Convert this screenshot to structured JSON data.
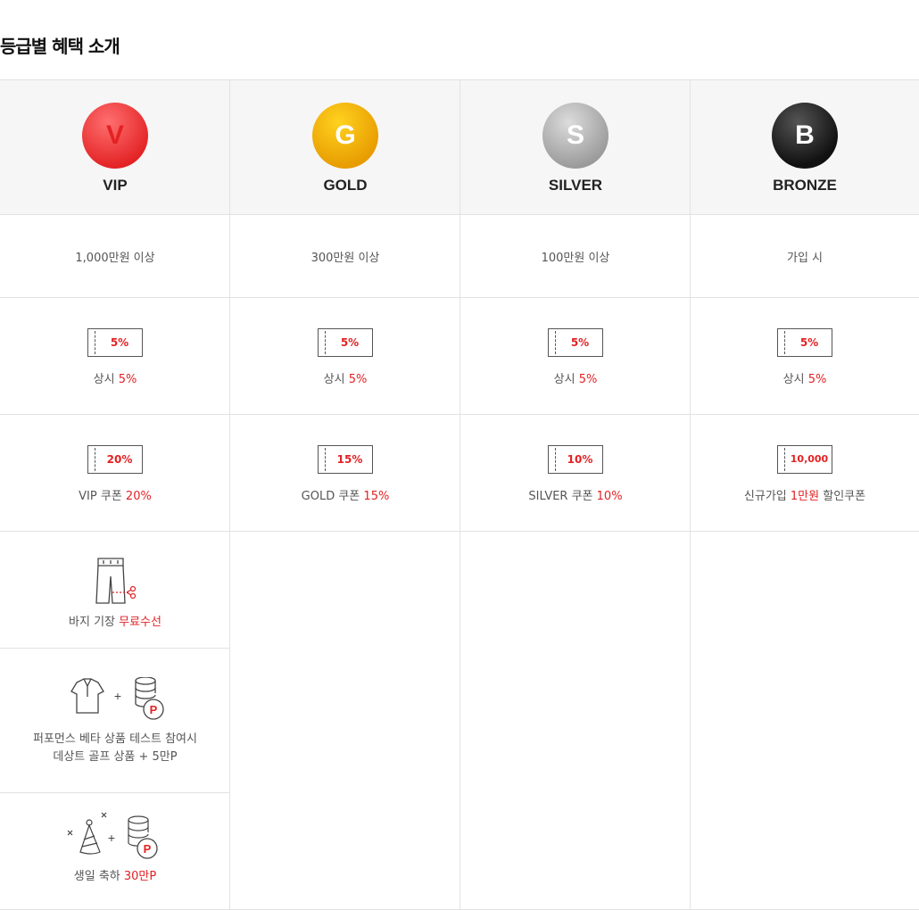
{
  "title": "등급별 혜택 소개",
  "colors": {
    "accent": "#e32224"
  },
  "grades": [
    {
      "letter": "V",
      "name": "VIP",
      "condition": "1,000만원 이상",
      "always_coupon": "5%",
      "always_label": "상시",
      "always_value": "5%",
      "coupon": "20%",
      "coupon_pre": "VIP 쿠폰",
      "coupon_value": "20%",
      "coupon_post": ""
    },
    {
      "letter": "G",
      "name": "GOLD",
      "condition": "300만원 이상",
      "always_coupon": "5%",
      "always_label": "상시",
      "always_value": "5%",
      "coupon": "15%",
      "coupon_pre": "GOLD 쿠폰",
      "coupon_value": "15%",
      "coupon_post": ""
    },
    {
      "letter": "S",
      "name": "SILVER",
      "condition": "100만원 이상",
      "always_coupon": "5%",
      "always_label": "상시",
      "always_value": "5%",
      "coupon": "10%",
      "coupon_pre": "SILVER 쿠폰",
      "coupon_value": "10%",
      "coupon_post": ""
    },
    {
      "letter": "B",
      "name": "BRONZE",
      "condition": "가입 시",
      "always_coupon": "5%",
      "always_label": "상시",
      "always_value": "5%",
      "coupon": "10,000",
      "coupon_pre": "신규가입",
      "coupon_value": "1만원",
      "coupon_post": "할인쿠폰"
    }
  ],
  "vip_extras": {
    "pants": {
      "pre": "바지 기장",
      "highlight": "무료수선",
      "icon": "pants-scissors-icon"
    },
    "beta": {
      "line1": "퍼포먼스 베타 상품 테스트 참여시",
      "line2": "데상트 골프 상품 + 5만P",
      "icon": "shirt-plus-points-icon"
    },
    "birthday": {
      "pre": "생일 축하",
      "highlight": "30만P",
      "icon": "party-hat-plus-points-icon"
    }
  }
}
